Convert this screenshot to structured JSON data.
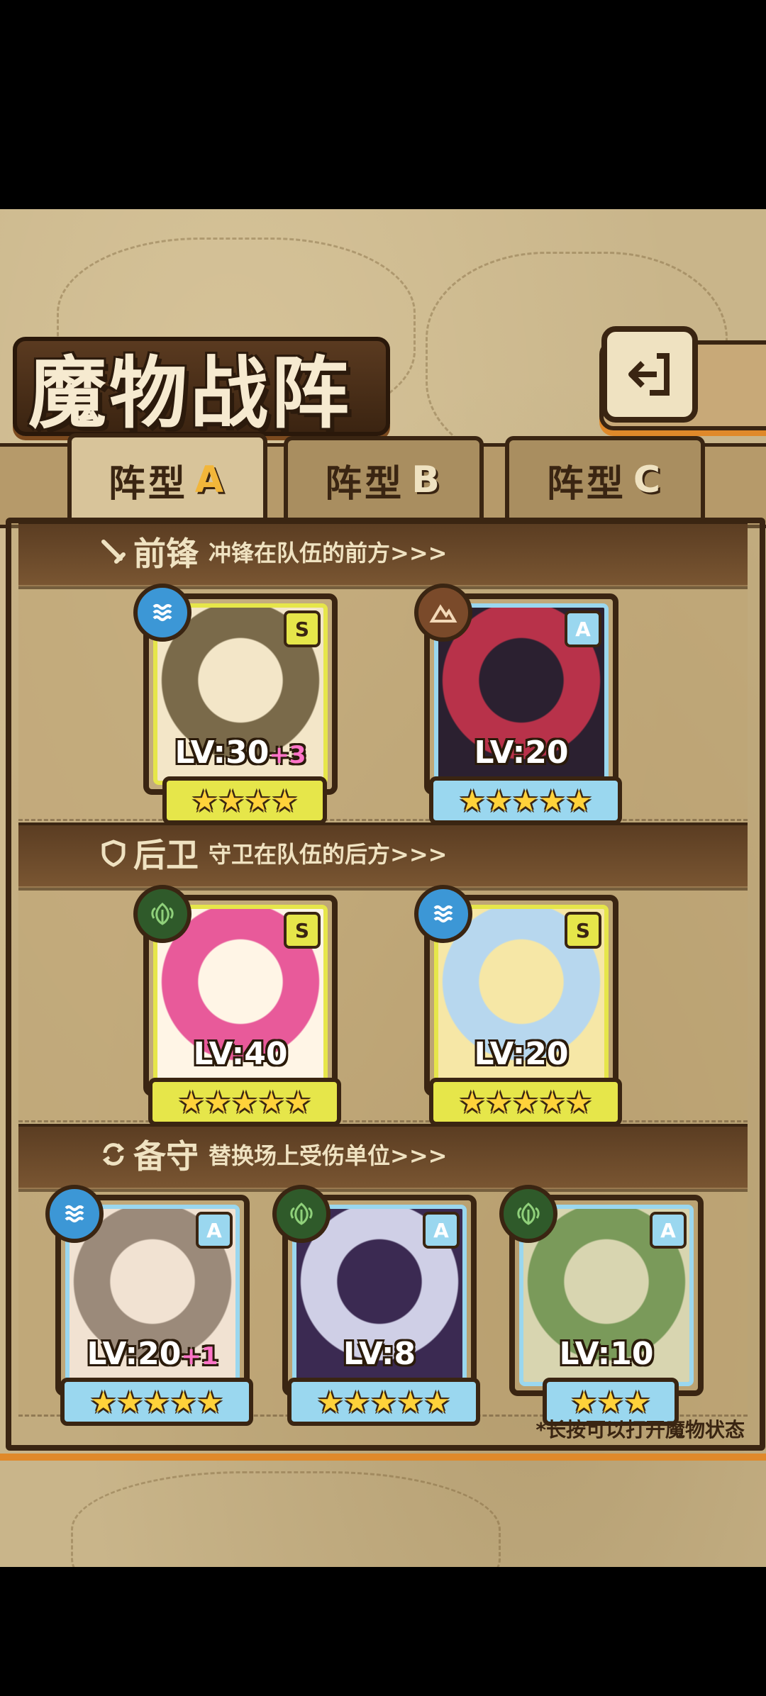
{
  "title": "魔物战阵",
  "tabs": [
    {
      "label": "阵型",
      "letter": "A",
      "active": true
    },
    {
      "label": "阵型",
      "letter": "B",
      "active": false
    },
    {
      "label": "阵型",
      "letter": "C",
      "active": false
    }
  ],
  "sections": {
    "front": {
      "name": "前锋",
      "desc": "冲锋在队伍的前方>>>",
      "icon": "sword-icon"
    },
    "rear": {
      "name": "后卫",
      "desc": "守卫在队伍的后方>>>",
      "icon": "shield-icon"
    },
    "reserve": {
      "name": "备守",
      "desc": "替换场上受伤单位>>>",
      "icon": "swap-icon"
    }
  },
  "cards": [
    {
      "id": "c1",
      "rank": "S",
      "element": "water",
      "level": "LV:30",
      "bonus": "+3",
      "stars": "★★★★",
      "star_count": 4
    },
    {
      "id": "c2",
      "rank": "A",
      "element": "earth",
      "level": "LV:20",
      "bonus": "",
      "stars": "★★★★★",
      "star_count": 5
    },
    {
      "id": "c3",
      "rank": "S",
      "element": "leaf",
      "level": "LV:40",
      "bonus": "",
      "stars": "★★★★★",
      "star_count": 5
    },
    {
      "id": "c4",
      "rank": "S",
      "element": "water",
      "level": "LV:20",
      "bonus": "",
      "stars": "★★★★★",
      "star_count": 5
    },
    {
      "id": "c5",
      "rank": "A",
      "element": "water",
      "level": "LV:20",
      "bonus": "+1",
      "stars": "★★★★★",
      "star_count": 5
    },
    {
      "id": "c6",
      "rank": "A",
      "element": "leaf",
      "level": "LV:8",
      "bonus": "",
      "stars": "★★★★★",
      "star_count": 5
    },
    {
      "id": "c7",
      "rank": "A",
      "element": "leaf",
      "level": "LV:10",
      "bonus": "",
      "stars": "★★★",
      "star_count": 3
    }
  ],
  "hint": "*长按可以打开魔物状态",
  "colors": {
    "rank_S": "#e6e64a",
    "rank_A": "#9ad7ef",
    "water": "#3c97d6",
    "earth": "#7a4a2a",
    "leaf": "#2f5a2a",
    "accent": "#e0892a"
  }
}
